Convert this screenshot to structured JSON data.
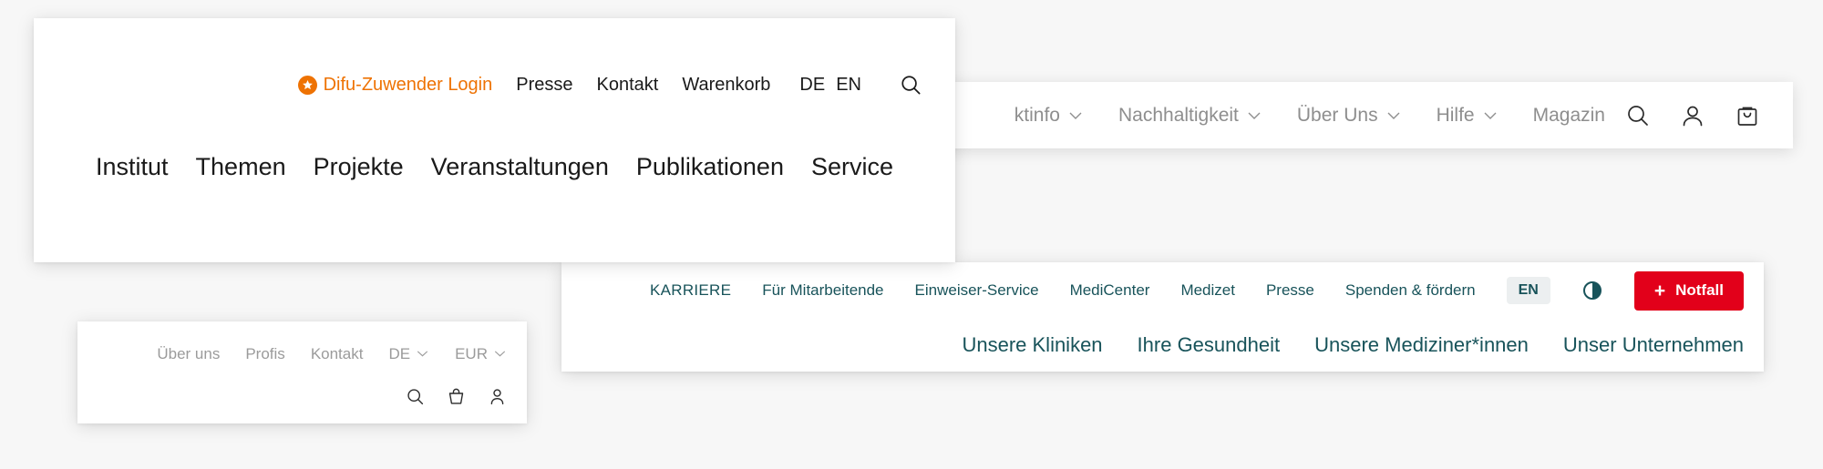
{
  "page": {
    "background_color": "#f7f7f7",
    "description": "Four overlapping website header navigation bar cards"
  },
  "difu_header": {
    "login": {
      "label": "Difu-Zuwender Login",
      "icon": "star-badge-icon",
      "color": "#ee7203"
    },
    "meta_links": [
      "Presse",
      "Kontakt",
      "Warenkorb"
    ],
    "languages": [
      "DE",
      "EN"
    ],
    "search_icon": "search-icon",
    "main_links": [
      "Institut",
      "Themen",
      "Projekte",
      "Veranstaltungen",
      "Publikationen",
      "Service"
    ],
    "text_color": "#1a1a1a"
  },
  "shop_nav": {
    "links": [
      {
        "label": "ktinfo",
        "has_chevron": true
      },
      {
        "label": "Nachhaltigkeit",
        "has_chevron": true
      },
      {
        "label": "Über Uns",
        "has_chevron": true
      },
      {
        "label": "Hilfe",
        "has_chevron": true
      },
      {
        "label": "Magazin",
        "has_chevron": false
      }
    ],
    "icons": [
      "search-icon",
      "user-icon",
      "shopping-bag-icon"
    ],
    "text_color": "#8e8e8e"
  },
  "mini_nav": {
    "links": [
      "Über uns",
      "Profis",
      "Kontakt"
    ],
    "selects": [
      {
        "label": "DE"
      },
      {
        "label": "EUR"
      }
    ],
    "icons": [
      "search-icon",
      "basket-icon",
      "user-icon"
    ],
    "text_color": "#9b9b9b"
  },
  "clinic_nav": {
    "meta_links": [
      "KARRIERE",
      "Für Mitarbeitende",
      "Einweiser-Service",
      "MediCenter",
      "Medizet",
      "Presse",
      "Spenden & fördern"
    ],
    "language_badge": "EN",
    "contrast_icon": "contrast-toggle-icon",
    "emergency_button": {
      "label": "Notfall",
      "icon": "plus-icon",
      "color": "#e2001a"
    },
    "main_links": [
      "Unsere Kliniken",
      "Ihre Gesundheit",
      "Unsere Mediziner*innen",
      "Unser Unternehmen"
    ],
    "text_color": "#18535a"
  }
}
